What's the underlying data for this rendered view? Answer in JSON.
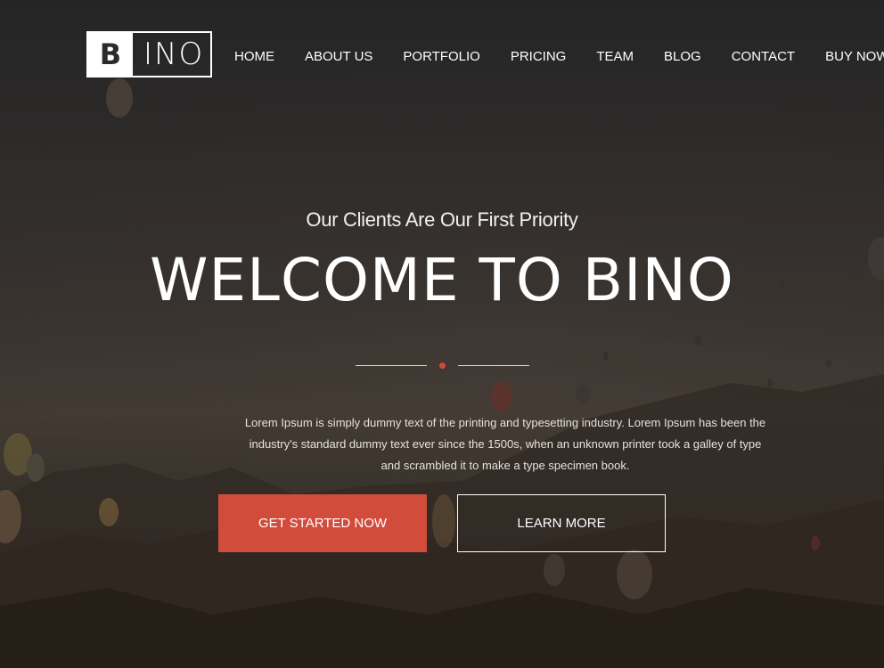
{
  "brand": {
    "logo_letter": "B",
    "logo_rest": "INO"
  },
  "nav": {
    "items": [
      {
        "label": "HOME"
      },
      {
        "label": "ABOUT US"
      },
      {
        "label": "PORTFOLIO"
      },
      {
        "label": "PRICING"
      },
      {
        "label": "TEAM"
      },
      {
        "label": "BLOG"
      },
      {
        "label": "CONTACT"
      },
      {
        "label": "BUY NOW"
      }
    ]
  },
  "hero": {
    "subtitle": "Our Clients Are Our First Priority",
    "title": "WELCOME TO BINO",
    "description_lines": [
      "Lorem Ipsum is simply dummy text of the printing and typesetting industry. Lorem Ipsum has been the",
      "industry's standard dummy text ever since the 1500s, when an unknown printer took a galley of type",
      "and scrambled it to make a type specimen book."
    ],
    "primary_button": "GET STARTED NOW",
    "secondary_button": "LEARN MORE"
  },
  "colors": {
    "accent": "#d24c3c",
    "text": "#ffffff"
  },
  "background": {
    "icon": "hot-air-balloon-landscape-photo"
  }
}
